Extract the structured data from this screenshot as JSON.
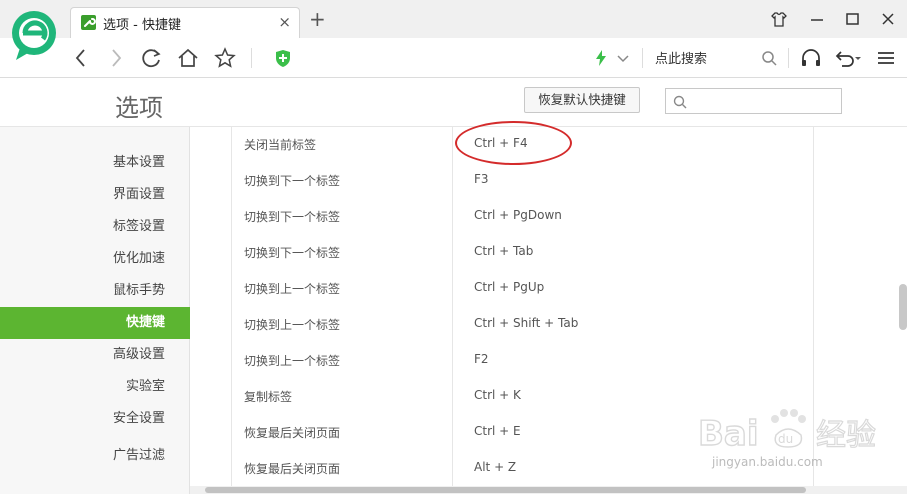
{
  "browser": {
    "tab_title": "选项 - 快捷键",
    "tab_close": "×",
    "new_tab": "+",
    "nav_search_text": "点此搜索"
  },
  "options": {
    "title": "选项",
    "reset_button": "恢复默认快捷键",
    "search_placeholder": "",
    "search_value": ""
  },
  "sidebar": {
    "items": [
      {
        "label": "基本设置"
      },
      {
        "label": "界面设置"
      },
      {
        "label": "标签设置"
      },
      {
        "label": "优化加速"
      },
      {
        "label": "鼠标手势"
      },
      {
        "label": "快捷键"
      },
      {
        "label": "高级设置"
      },
      {
        "label": "实验室"
      },
      {
        "label": "安全设置"
      },
      {
        "label": "广告过滤"
      }
    ],
    "active": "快捷键"
  },
  "shortcuts": {
    "rows": [
      {
        "name": "关闭当前标签",
        "key": "Ctrl + F4"
      },
      {
        "name": "切换到下一个标签",
        "key": "F3"
      },
      {
        "name": "切换到下一个标签",
        "key": "Ctrl + PgDown"
      },
      {
        "name": "切换到下一个标签",
        "key": "Ctrl + Tab"
      },
      {
        "name": "切换到上一个标签",
        "key": "Ctrl + PgUp"
      },
      {
        "name": "切换到上一个标签",
        "key": "Ctrl + Shift + Tab"
      },
      {
        "name": "切换到上一个标签",
        "key": "F2"
      },
      {
        "name": "复制标签",
        "key": "Ctrl + K"
      },
      {
        "name": "恢复最后关闭页面",
        "key": "Ctrl + E"
      },
      {
        "name": "恢复最后关闭页面",
        "key": "Alt + Z"
      }
    ]
  },
  "colors": {
    "accent": "#5cb531",
    "annotation": "#d42b2b"
  },
  "watermark": {
    "brand": "Bai经验",
    "url": "jingyan.baidu.com"
  }
}
